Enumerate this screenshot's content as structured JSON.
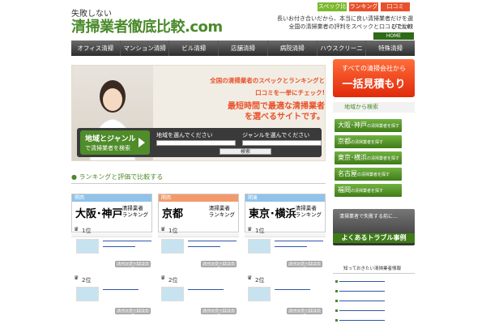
{
  "header": {
    "tagline": "失敗しない",
    "logo": "清掃業者徹底比較.com",
    "top_links": [
      "スペック比較",
      "ランキング",
      "口コミ"
    ],
    "desc_line1": "長いお付き合いだから、本当に良い清掃業者だけを選びたい!!",
    "desc_line2": "全国の清掃業者の評判をスペックと口コミで比較",
    "home_label": "HOME"
  },
  "nav": [
    "オフィス清掃",
    "マンション清掃",
    "ビル清掃",
    "店舗清掃",
    "病院清掃",
    "ハウスクリーニング",
    "特殊清掃"
  ],
  "hero": {
    "line1": "全国の清掃業者のスペックとランキングと",
    "line2": "口コミを一挙にチェック!",
    "line3": "最短時間で最適な清掃業者",
    "line4": "を選べるサイトです。",
    "search_title": "地域とジャンル",
    "search_sub": "で清掃業者を検索",
    "area_label": "地域を選んでください",
    "genre_label": "ジャンルを選んでください",
    "search_button": "検索"
  },
  "section_title": "ランキングと評価で比較する",
  "cards": [
    {
      "region": "関西",
      "tag": "kansai",
      "city": "大阪･神戸",
      "sub1": "清掃業者",
      "sub2": "ランキング",
      "head_color": "#8fc3ea"
    },
    {
      "region": "関西",
      "tag": "kansai",
      "city": "京都",
      "sub1": "清掃業者",
      "sub2": "ランキング",
      "head_color": "#f39a6c"
    },
    {
      "region": "関東",
      "tag": "kantou",
      "city": "東京･横浜",
      "sub1": "清掃業者",
      "sub2": "ランキング",
      "head_color": "#8fc3ea"
    }
  ],
  "ranks": {
    "first": "1位",
    "second": "2位"
  },
  "more_label": "スペック・口コミを見る",
  "sidebar": {
    "cta_line1": "すべての清掃会社から",
    "cta_line2": "一括見積もり",
    "area_title": "地域から検索",
    "areas": [
      {
        "name": "大阪･神戸",
        "suffix": "の清掃業者を探す"
      },
      {
        "name": "京都",
        "suffix": "の清掃業者を探す"
      },
      {
        "name": "東京･横浜",
        "suffix": "の清掃業者を探す"
      },
      {
        "name": "名古屋",
        "suffix": "の清掃業者を探す"
      },
      {
        "name": "福岡",
        "suffix": "の清掃業者を探す"
      }
    ],
    "trouble_line1": "清掃業者で失敗する前に…",
    "trouble_line2": "よくあるトラブル事例",
    "info_title": "知っておきたい清掃業者情報"
  }
}
